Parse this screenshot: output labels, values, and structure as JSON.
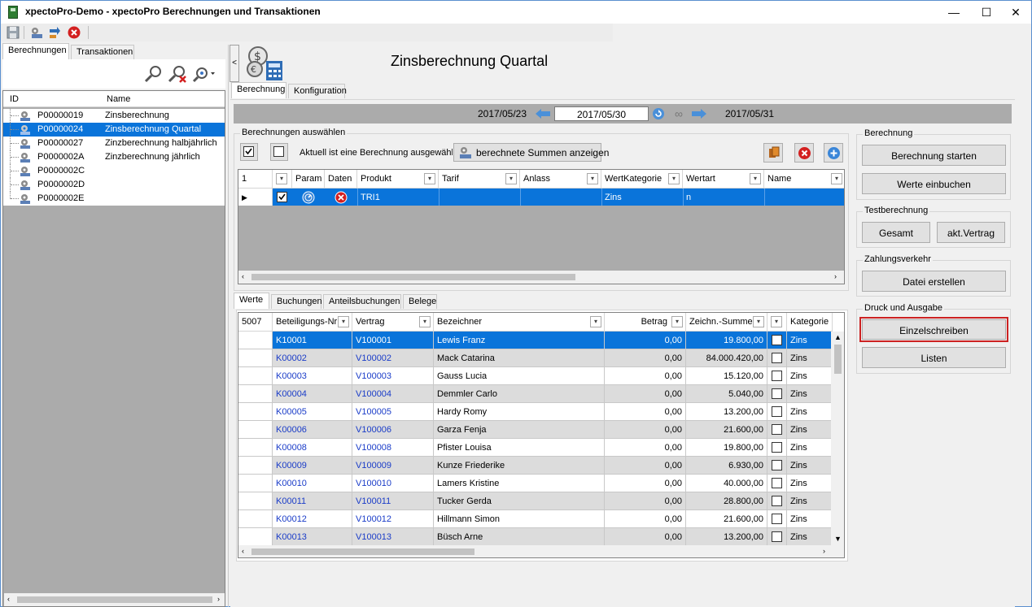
{
  "window": {
    "title": "xpectoPro-Demo - xpectoPro Berechnungen und Transaktionen",
    "minimize": "—",
    "maximize": "☐",
    "close": "✕"
  },
  "left": {
    "tabs": [
      "Berechnungen",
      "Transaktionen"
    ],
    "columns": [
      "ID",
      "Name"
    ],
    "rows": [
      {
        "id": "P00000019",
        "name": "Zinsberechnung"
      },
      {
        "id": "P00000024",
        "name": "Zinsberechnung Quartal"
      },
      {
        "id": "P00000027",
        "name": "Zinzberechnung halbjährlich"
      },
      {
        "id": "P0000002A",
        "name": "Zinzberechnung jährlich"
      },
      {
        "id": "P0000002C",
        "name": ""
      },
      {
        "id": "P0000002D",
        "name": ""
      },
      {
        "id": "P0000002E",
        "name": ""
      }
    ],
    "collapse": "<"
  },
  "main": {
    "title": "Zinsberechnung Quartal",
    "tabs": [
      "Berechnung",
      "Konfiguration"
    ],
    "nav": {
      "prev": "2017/05/23",
      "current": "2017/05/30",
      "next": "2017/05/31",
      "infinity": "∞"
    }
  },
  "select_group": {
    "label": "Berechnungen auswählen",
    "checkbox_text": "Aktuell ist eine Berechnung ausgewählt",
    "show_sums_button": "berechnete Summen anzeigen",
    "grid": {
      "count": "1",
      "columns": [
        "Param",
        "Daten",
        "Produkt",
        "Tarif",
        "Anlass",
        "WertKategorie",
        "Wertart",
        "Name"
      ],
      "row": {
        "produkt": "TRI1",
        "wertkategorie": "Zins",
        "wertart": "n"
      }
    }
  },
  "right": {
    "groups": [
      {
        "label": "Berechnung",
        "buttons": [
          "Berechnung starten",
          "Werte einbuchen"
        ]
      },
      {
        "label": "Testberechnung",
        "buttons": [
          "Gesamt",
          "akt.Vertrag"
        ]
      },
      {
        "label": "Zahlungsverkehr",
        "buttons": [
          "Datei erstellen"
        ]
      },
      {
        "label": "Druck und Ausgabe",
        "buttons": [
          "Einzelschreiben",
          "Listen"
        ]
      }
    ]
  },
  "lower": {
    "tabs": [
      "Werte",
      "Buchungen",
      "Anteilsbuchungen",
      "Belege"
    ],
    "count": "5007",
    "columns": [
      "Beteiligungs-Nr",
      "Vertrag",
      "Bezeichner",
      "Betrag",
      "Zeichn.-Summe",
      "",
      "Kategorie"
    ],
    "rows": [
      {
        "bet": "K10001",
        "vertrag": "V100001",
        "bez": "Lewis Franz",
        "betrag": "0,00",
        "summe": "19.800,00",
        "kat": "Zins"
      },
      {
        "bet": "K00002",
        "vertrag": "V100002",
        "bez": "Mack Catarina",
        "betrag": "0,00",
        "summe": "84.000.420,00",
        "kat": "Zins"
      },
      {
        "bet": "K00003",
        "vertrag": "V100003",
        "bez": "Gauss Lucia",
        "betrag": "0,00",
        "summe": "15.120,00",
        "kat": "Zins"
      },
      {
        "bet": "K00004",
        "vertrag": "V100004",
        "bez": "Demmler Carlo",
        "betrag": "0,00",
        "summe": "5.040,00",
        "kat": "Zins"
      },
      {
        "bet": "K00005",
        "vertrag": "V100005",
        "bez": "Hardy Romy",
        "betrag": "0,00",
        "summe": "13.200,00",
        "kat": "Zins"
      },
      {
        "bet": "K00006",
        "vertrag": "V100006",
        "bez": "Garza Fenja",
        "betrag": "0,00",
        "summe": "21.600,00",
        "kat": "Zins"
      },
      {
        "bet": "K00008",
        "vertrag": "V100008",
        "bez": "Pfister Louisa",
        "betrag": "0,00",
        "summe": "19.800,00",
        "kat": "Zins"
      },
      {
        "bet": "K00009",
        "vertrag": "V100009",
        "bez": "Kunze Friederike",
        "betrag": "0,00",
        "summe": "6.930,00",
        "kat": "Zins"
      },
      {
        "bet": "K00010",
        "vertrag": "V100010",
        "bez": "Lamers Kristine",
        "betrag": "0,00",
        "summe": "40.000,00",
        "kat": "Zins"
      },
      {
        "bet": "K00011",
        "vertrag": "V100011",
        "bez": "Tucker Gerda",
        "betrag": "0,00",
        "summe": "28.800,00",
        "kat": "Zins"
      },
      {
        "bet": "K00012",
        "vertrag": "V100012",
        "bez": "Hillmann Simon",
        "betrag": "0,00",
        "summe": "21.600,00",
        "kat": "Zins"
      },
      {
        "bet": "K00013",
        "vertrag": "V100013",
        "bez": "Büsch Arne",
        "betrag": "0,00",
        "summe": "13.200,00",
        "kat": "Zins"
      }
    ]
  },
  "colors": {
    "selection": "#0a74da",
    "link": "#1a3cc8",
    "highlight_border": "#cc2222",
    "panel_gray": "#ababab"
  }
}
